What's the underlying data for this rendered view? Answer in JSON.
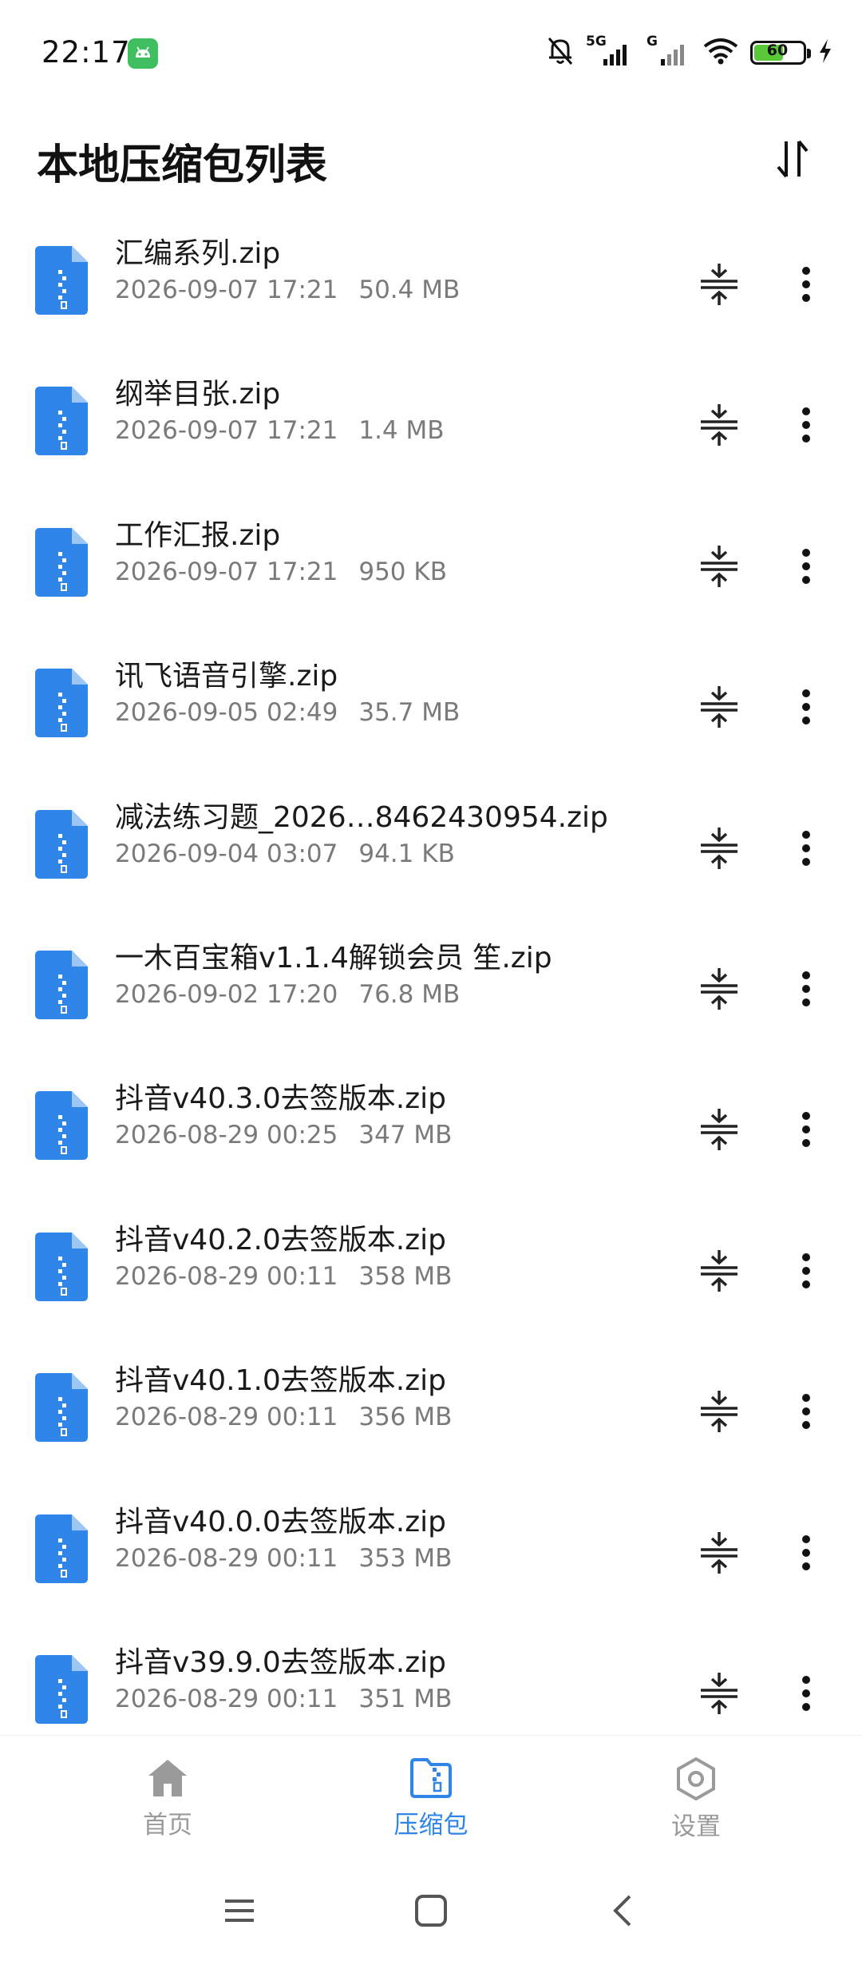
{
  "status_bar": {
    "time": "22:17",
    "network_label": "5G",
    "network_label_2": "G",
    "battery_level": "60",
    "battery_fraction": 0.6,
    "icons": [
      "android-icon",
      "mute-bell-icon",
      "signal-icon",
      "wifi-icon",
      "battery-icon",
      "charging-bolt-icon"
    ]
  },
  "header": {
    "title": "本地压缩包列表",
    "sort_icon": "sort-arrows-icon"
  },
  "files": [
    {
      "name": "汇编系列.zip",
      "date": "2026-09-07 17:21",
      "size": "50.4 MB"
    },
    {
      "name": "纲举目张.zip",
      "date": "2026-09-07 17:21",
      "size": "1.4 MB"
    },
    {
      "name": "工作汇报.zip",
      "date": "2026-09-07 17:21",
      "size": "950 KB"
    },
    {
      "name": "讯飞语音引擎.zip",
      "date": "2026-09-05 02:49",
      "size": "35.7 MB"
    },
    {
      "name": "减法练习题_2026…8462430954.zip",
      "date": "2026-09-04 03:07",
      "size": "94.1 KB"
    },
    {
      "name": "一木百宝箱v1.1.4解锁会员 笙.zip",
      "date": "2026-09-02 17:20",
      "size": "76.8 MB"
    },
    {
      "name": "抖音v40.3.0去签版本.zip",
      "date": "2026-08-29 00:25",
      "size": "347 MB"
    },
    {
      "name": "抖音v40.2.0去签版本.zip",
      "date": "2026-08-29 00:11",
      "size": "358 MB"
    },
    {
      "name": "抖音v40.1.0去签版本.zip",
      "date": "2026-08-29 00:11",
      "size": "356 MB"
    },
    {
      "name": "抖音v40.0.0去签版本.zip",
      "date": "2026-08-29 00:11",
      "size": "353 MB"
    },
    {
      "name": "抖音v39.9.0去签版本.zip",
      "date": "2026-08-29 00:11",
      "size": "351 MB"
    }
  ],
  "row_icons": {
    "file": "zip-file-icon",
    "extract": "extract-icon",
    "more": "more-vertical-icon"
  },
  "bottom_nav": {
    "items": [
      {
        "label": "首页",
        "icon": "home-icon",
        "active": false
      },
      {
        "label": "压缩包",
        "icon": "archive-folder-icon",
        "active": true
      },
      {
        "label": "设置",
        "icon": "settings-hexagon-icon",
        "active": false
      }
    ],
    "active_color": "#2f86e8",
    "inactive_color": "#9a9a9a"
  },
  "system_nav": {
    "icons": [
      "menu-icon",
      "home-square-icon",
      "back-icon"
    ]
  },
  "colors": {
    "file_icon": "#2f86e8",
    "text": "#1a1a1a",
    "meta": "#7a7a7a"
  }
}
